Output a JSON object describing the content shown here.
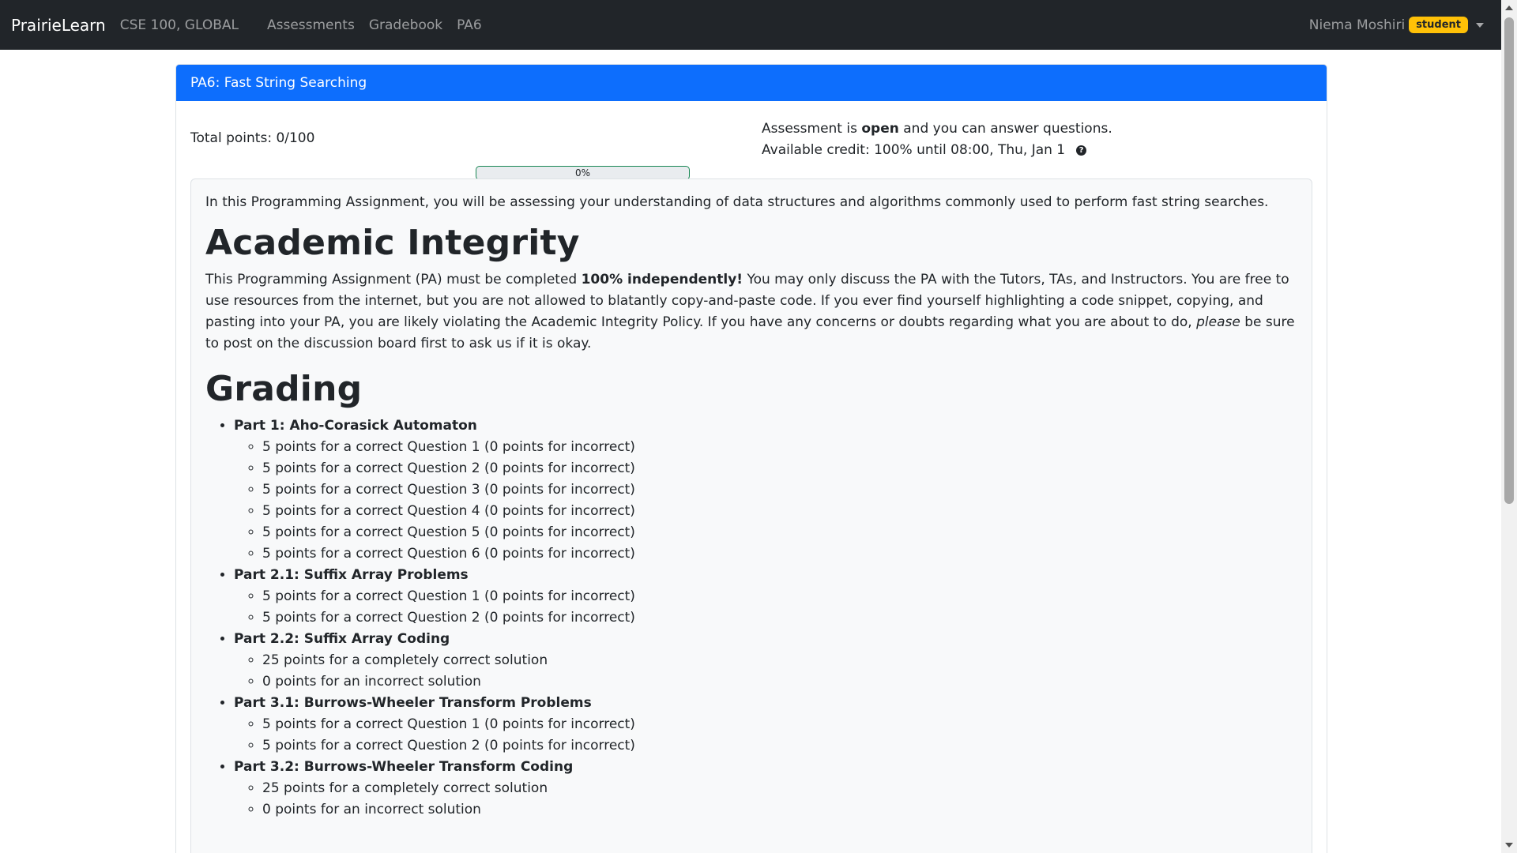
{
  "nav": {
    "brand": "PrairieLearn",
    "course": "CSE 100, GLOBAL",
    "links": [
      "Assessments",
      "Gradebook",
      "PA6"
    ],
    "user": "Niema Moshiri",
    "role": "student"
  },
  "card": {
    "title": "PA6: Fast String Searching",
    "total_points": "Total points: 0/100",
    "progress_label": "0%",
    "progress_fraction": 0,
    "status_prefix": "Assessment is ",
    "status_bold": "open",
    "status_suffix": " and you can answer questions.",
    "credit": "Available credit: 100% until 08:00, Thu, Jan 1"
  },
  "content": {
    "intro": "In this Programming Assignment, you will be assessing your understanding of data structures and algorithms commonly used to perform fast string searches.",
    "integrity_heading": "Academic Integrity",
    "integrity_1": "This Programming Assignment (PA) must be completed ",
    "integrity_bold": "100% independently!",
    "integrity_2": " You may only discuss the PA with the Tutors, TAs, and Instructors. You are free to use resources from the internet, but you are not allowed to blatantly copy-and-paste code. If you ever find yourself highlighting a code snippet, copying, and pasting into your PA, you are likely violating the Academic Integrity Policy. If you have any concerns or doubts regarding what you are about to do, ",
    "integrity_em": "please",
    "integrity_3": " be sure to post on the discussion board first to ask us if it is okay.",
    "grading_heading": "Grading",
    "parts": [
      {
        "title": "Part 1: Aho-Corasick Automaton",
        "items": [
          "5 points for a correct Question 1 (0 points for incorrect)",
          "5 points for a correct Question 2 (0 points for incorrect)",
          "5 points for a correct Question 3 (0 points for incorrect)",
          "5 points for a correct Question 4 (0 points for incorrect)",
          "5 points for a correct Question 5 (0 points for incorrect)",
          "5 points for a correct Question 6 (0 points for incorrect)"
        ]
      },
      {
        "title": "Part 2.1: Suffix Array Problems",
        "items": [
          "5 points for a correct Question 1 (0 points for incorrect)",
          "5 points for a correct Question 2 (0 points for incorrect)"
        ]
      },
      {
        "title": "Part 2.2: Suffix Array Coding",
        "items": [
          "25 points for a completely correct solution",
          "0 points for an incorrect solution"
        ]
      },
      {
        "title": "Part 3.1: Burrows-Wheeler Transform Problems",
        "items": [
          "5 points for a correct Question 1 (0 points for incorrect)",
          "5 points for a correct Question 2 (0 points for incorrect)"
        ]
      },
      {
        "title": "Part 3.2: Burrows-Wheeler Transform Coding",
        "items": [
          "25 points for a completely correct solution",
          "0 points for an incorrect solution"
        ]
      }
    ]
  }
}
